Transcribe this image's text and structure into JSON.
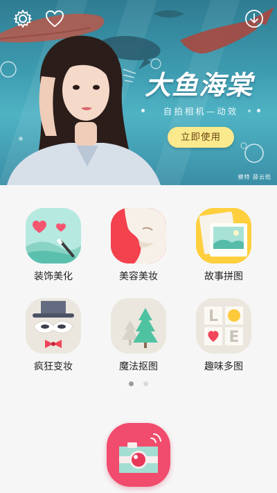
{
  "banner": {
    "title": "大鱼海棠",
    "subtitle": "自拍相机—动效",
    "cta_label": "立即使用",
    "credit": "模特 薛云皓"
  },
  "features": [
    {
      "label": "装饰美化",
      "icon": "decorate-icon"
    },
    {
      "label": "美容美妆",
      "icon": "beauty-icon"
    },
    {
      "label": "故事拼图",
      "icon": "story-collage-icon"
    },
    {
      "label": "疯狂变妆",
      "icon": "crazy-makeup-icon"
    },
    {
      "label": "魔法抠图",
      "icon": "magic-cutout-icon"
    },
    {
      "label": "趣味多图",
      "icon": "fun-multi-photo-icon"
    }
  ],
  "pager": {
    "total": 2,
    "active": 1
  },
  "colors": {
    "accent": "#f14b6d",
    "cta_bg": "#fbe98e",
    "banner_bg": "#3d9bb0"
  }
}
